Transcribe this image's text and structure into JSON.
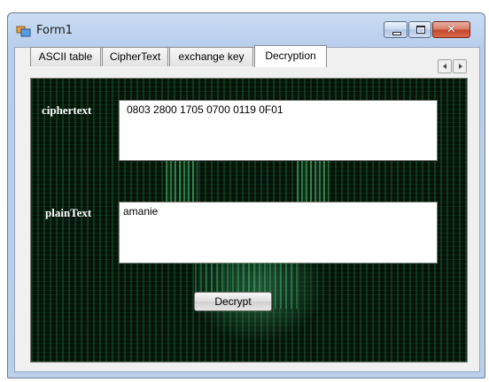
{
  "window": {
    "title": "Form1",
    "close_glyph": "✕"
  },
  "tabs": [
    {
      "label": "ASCII table"
    },
    {
      "label": "CipherText"
    },
    {
      "label": "exchange key"
    },
    {
      "label": "Decryption",
      "selected": true
    }
  ],
  "decryption": {
    "ciphertext_label": "ciphertext",
    "ciphertext_value": "0803 2800 1705 0700 0119 0F01",
    "plaintext_label": "plainText",
    "plaintext_value": "amanie",
    "decrypt_button": "Decrypt"
  },
  "icons": [
    "app-icon",
    "minimize-icon",
    "maximize-icon",
    "close-icon",
    "scroll-left-icon",
    "scroll-right-icon"
  ],
  "colors": {
    "title_bar": "#bccfe8",
    "close_button": "#c5452a",
    "tabpage_background": "#061208",
    "label_text": "#ffffff"
  }
}
